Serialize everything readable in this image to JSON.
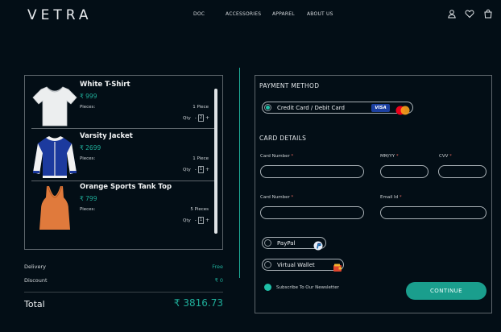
{
  "header": {
    "logo": "VETRA",
    "nav": [
      "DOC",
      "ACCESSORIES",
      "APPAREL",
      "ABOUT US"
    ],
    "icons": [
      "user-icon",
      "heart-icon",
      "bag-icon"
    ]
  },
  "cart": {
    "items": [
      {
        "name": "White T-Shirt",
        "price": "₹ 999",
        "pieces_label": "Pieces:",
        "pieces_value": "1 Piece",
        "qty_label": "Qty",
        "qty_value": "2",
        "image": "white-tshirt-image"
      },
      {
        "name": "Varsity Jacket",
        "price": "₹ 2699",
        "pieces_label": "Pieces:",
        "pieces_value": "1 Piece",
        "qty_label": "Qty",
        "qty_value": "1",
        "image": "varsity-jacket-image"
      },
      {
        "name": "Orange Sports Tank Top",
        "price": "₹ 799",
        "pieces_label": "Pieces:",
        "pieces_value": "5 Pieces",
        "qty_label": "Qty",
        "qty_value": "1",
        "image": "orange-tank-top-image"
      }
    ],
    "minus": "-",
    "plus": "+"
  },
  "summary": {
    "delivery_label": "Delivery",
    "delivery_value": "Free",
    "discount_label": "Discount",
    "discount_value": "₹ 0",
    "total_label": "Total",
    "total_value": "₹ 3816.73"
  },
  "payment": {
    "title": "PAYMENT METHOD",
    "card_option": "Credit Card / Debit Card",
    "visa": "VISA",
    "card_details_title": "CARD DETAILS",
    "card_number_label": "Card Number",
    "mmyy_label": "MM/YY",
    "cvv_label": "CVV",
    "card_number2_label": "Card Number",
    "email_label": "Email Id",
    "required_mark": "*",
    "paypal_option": "PayPal",
    "wallet_option": "Virtual Wallet",
    "newsletter_label": "Subscribe To Our Newsletter",
    "continue_label": "CONTINUE"
  },
  "colors": {
    "background": "#030e16",
    "accent": "#1fae9a",
    "button": "#1a9e8d",
    "border": "#5e666c"
  }
}
